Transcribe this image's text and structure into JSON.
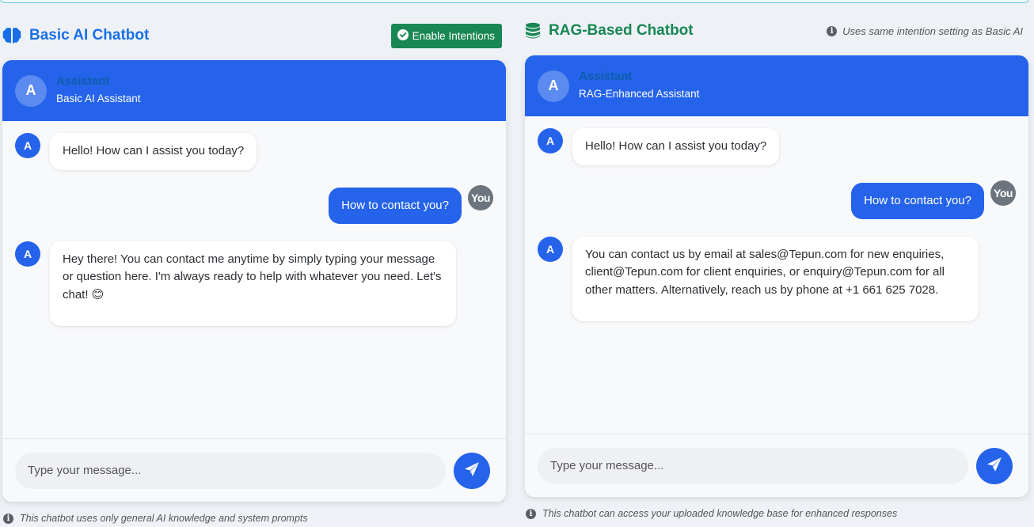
{
  "basic": {
    "title": "Basic AI Chatbot",
    "intent_button": "Enable Intentions",
    "assistant_name": "Assistant",
    "assistant_sub": "Basic AI Assistant",
    "avatar_letter": "A",
    "messages": [
      {
        "role": "bot",
        "text": "Hello! How can I assist you today?"
      },
      {
        "role": "user",
        "text": "How to contact you?"
      },
      {
        "role": "bot",
        "text": "Hey there! You can contact me anytime by simply typing your message or question here. I'm always ready to help with whatever you need. Let's chat! 😊"
      }
    ],
    "input_placeholder": "Type your message...",
    "footnote": "This chatbot uses only general AI knowledge and system prompts"
  },
  "rag": {
    "title": "RAG-Based Chatbot",
    "intent_note": "Uses same intention setting as Basic AI",
    "assistant_name": "Assistant",
    "assistant_sub": "RAG-Enhanced Assistant",
    "avatar_letter": "A",
    "messages": [
      {
        "role": "bot",
        "text": "Hello! How can I assist you today?"
      },
      {
        "role": "user",
        "text": "How to contact you?"
      },
      {
        "role": "bot",
        "text": "You can contact us by email at sales@Tepun.com for new enquiries, client@Tepun.com for client enquiries, or enquiry@Tepun.com for all other matters. Alternatively, reach us by phone at +1 661 625 7028."
      }
    ],
    "input_placeholder": "Type your message...",
    "footnote": "This chatbot can access your uploaded knowledge base for enhanced responses"
  },
  "user_avatar": "You",
  "info_glyph": "i",
  "colors": {
    "primary": "#2563eb",
    "success": "#198754",
    "basic_title": "#1a6fe8"
  }
}
